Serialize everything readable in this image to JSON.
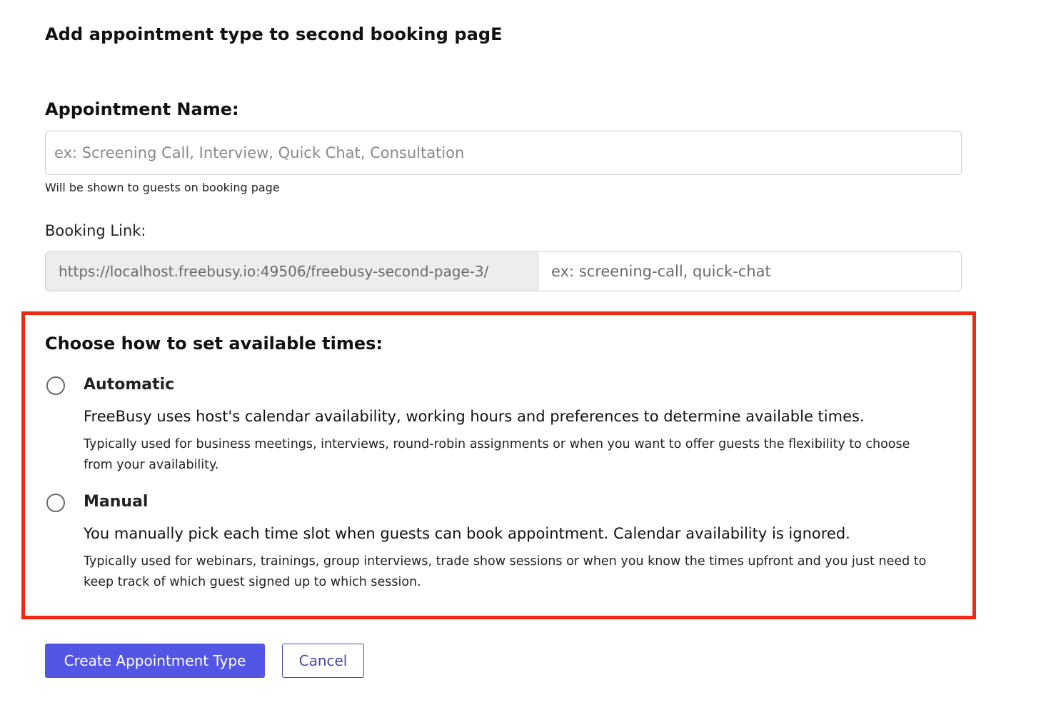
{
  "page": {
    "title": "Add appointment type to second booking pagE"
  },
  "appointment_name": {
    "label": "Appointment Name:",
    "value": "",
    "placeholder": "ex: Screening Call, Interview, Quick Chat, Consultation",
    "help": "Will be shown to guests on booking page"
  },
  "booking_link": {
    "label": "Booking Link:",
    "prefix": "https://localhost.freebusy.io:49506/freebusy-second-page-3/",
    "value": "",
    "placeholder": "ex: screening-call, quick-chat"
  },
  "availability": {
    "title": "Choose how to set available times:",
    "highlight_color": "#f0290f",
    "options": [
      {
        "label": "Automatic",
        "selected": false,
        "description": "FreeBusy uses host's calendar availability, working hours and preferences to determine available times.",
        "note": "Typically used for business meetings, interviews, round-robin assignments or when you want to offer guests the flexibility to choose from your availability."
      },
      {
        "label": "Manual",
        "selected": false,
        "description": "You manually pick each time slot when guests can book appointment. Calendar availability is ignored.",
        "note": "Typically used for webinars, trainings, group interviews, trade show sessions or when you know the times upfront and you just need to keep track of which guest signed up to which session."
      }
    ]
  },
  "actions": {
    "create_label": "Create Appointment Type",
    "cancel_label": "Cancel",
    "primary_color": "#5356e5"
  }
}
